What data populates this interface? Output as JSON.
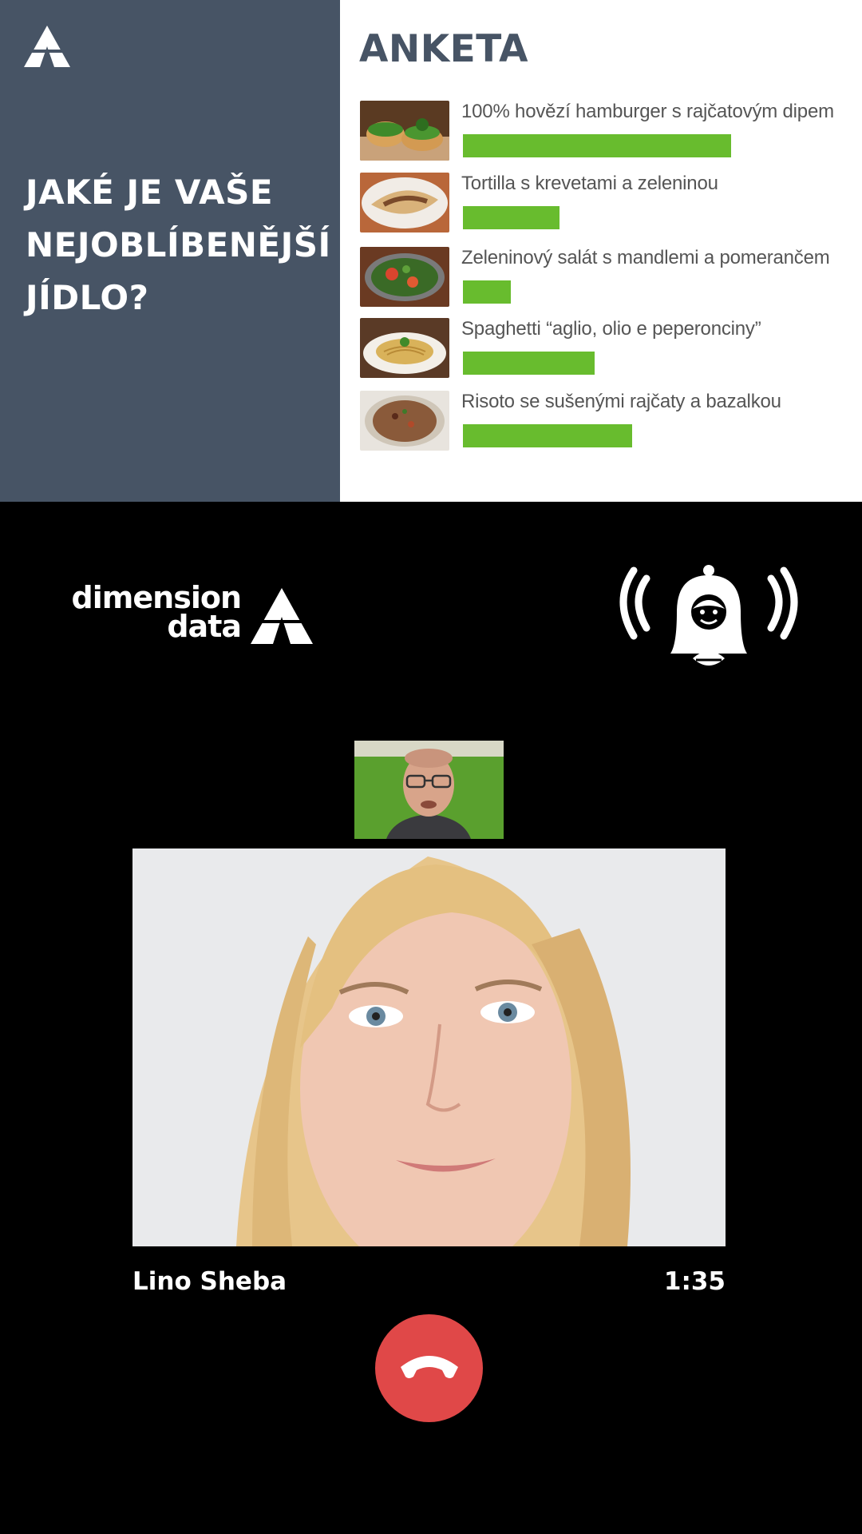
{
  "poll": {
    "title": "ANKETA",
    "question": "JAKÉ JE VAŠE NEJOBLÍBENĚJŠÍ JÍDLO?",
    "bar_color": "#68bc2e",
    "items": [
      {
        "label": "100% hovězí hamburger s rajčatovým dipem",
        "share": 1.0,
        "thumb_icon": "burger-photo"
      },
      {
        "label": "Tortilla s krevetami a zeleninou",
        "share": 0.36,
        "thumb_icon": "tortilla-photo"
      },
      {
        "label": "Zeleninový salát s mandlemi a pomerančem",
        "share": 0.18,
        "thumb_icon": "salad-photo"
      },
      {
        "label": "Spaghetti “aglio, olio e peperonciny”",
        "share": 0.49,
        "thumb_icon": "spaghetti-photo"
      },
      {
        "label": "Risoto se sušenými rajčaty a bazalkou",
        "share": 0.63,
        "thumb_icon": "risotto-photo"
      }
    ]
  },
  "brand": {
    "line1": "dimension",
    "line2": "data"
  },
  "call": {
    "caller_name": "Lino Sheba",
    "duration": "1:35",
    "hangup_color": "#e04848"
  },
  "colors": {
    "panel": "#475465",
    "background": "#000000"
  }
}
